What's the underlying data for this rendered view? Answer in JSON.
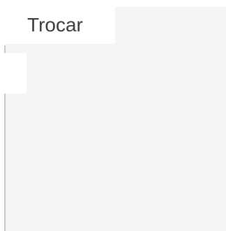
{
  "tab": {
    "label": "Trocar"
  },
  "colors": {
    "panel_background": "#f5f5f8",
    "page_background": "#ffffff",
    "rule": "#c9c9cd",
    "text": "#3b3b3b"
  }
}
